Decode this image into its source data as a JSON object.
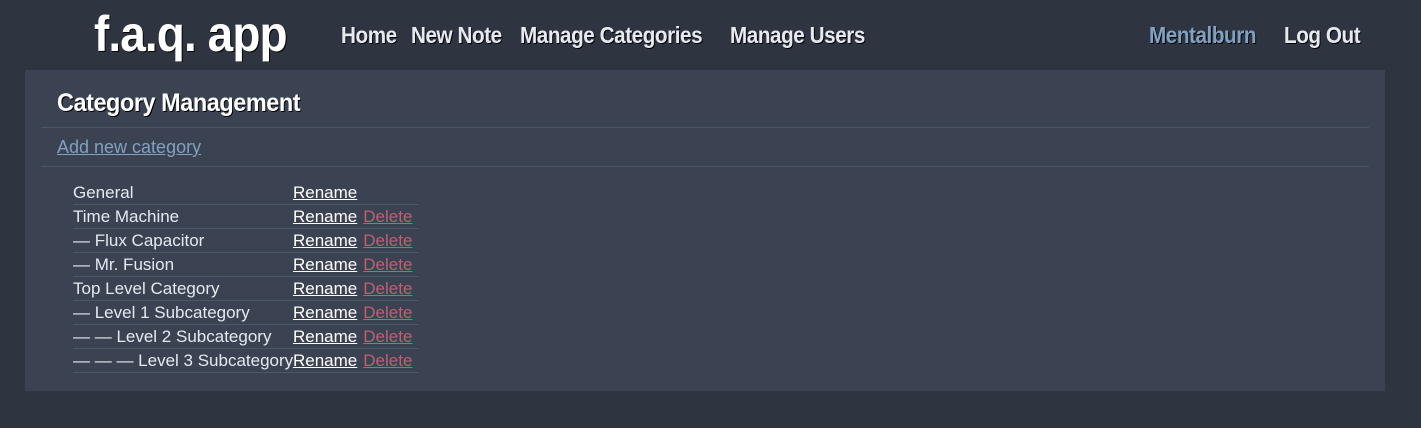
{
  "header": {
    "logo": "f.a.q. app",
    "nav": [
      {
        "label": "Home"
      },
      {
        "label": "New Note"
      },
      {
        "label": "Manage Categories"
      },
      {
        "label": "Manage Users"
      }
    ],
    "username": "Mentalburn",
    "logout_label": "Log Out"
  },
  "panel": {
    "title": "Category Management",
    "add_link": "Add new category",
    "rename_label": "Rename",
    "delete_label": "Delete",
    "categories": [
      {
        "name": "General",
        "deletable": false
      },
      {
        "name": "Time Machine",
        "deletable": true
      },
      {
        "name": "— Flux Capacitor",
        "deletable": true
      },
      {
        "name": "— Mr. Fusion",
        "deletable": true
      },
      {
        "name": "Top Level Category",
        "deletable": true
      },
      {
        "name": "— Level 1 Subcategory",
        "deletable": true
      },
      {
        "name": "— — Level 2 Subcategory",
        "deletable": true
      },
      {
        "name": "— — — Level 3 Subcategory",
        "deletable": true
      }
    ]
  },
  "colors": {
    "background": "#2e3440",
    "panel": "#3b4252",
    "accent": "#81a1c1",
    "danger": "#bf616a",
    "text": "#e5e9f0"
  }
}
